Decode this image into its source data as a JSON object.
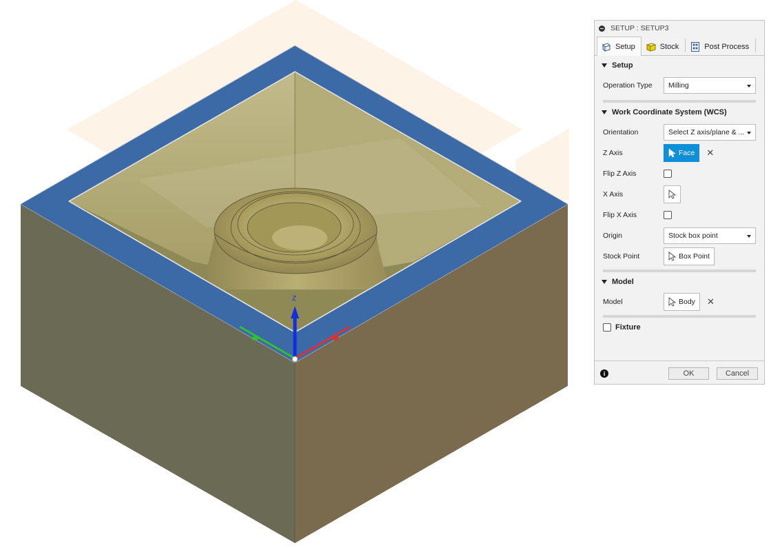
{
  "viewport": {
    "axis_label": "Z",
    "colors": {
      "front_left": "#6b6a55",
      "front_right": "#7a6b4e",
      "rim": "#3c6aa6",
      "inner": "#a8a06a",
      "boss": "#b0a56c",
      "ghost": "#fdf3e6",
      "z_axis": "#1030e0",
      "x_axis": "#e03030",
      "y_axis": "#30c030"
    }
  },
  "dialog": {
    "title": "SETUP : SETUP3",
    "tabs": [
      {
        "label": "Setup",
        "icon": "setup-icon"
      },
      {
        "label": "Stock",
        "icon": "stock-cube-icon"
      },
      {
        "label": "Post Process",
        "icon": "post-process-icon"
      }
    ],
    "setup_section": {
      "title": "Setup",
      "operation_type_label": "Operation Type",
      "operation_type_value": "Milling"
    },
    "wcs_section": {
      "title": "Work Coordinate System (WCS)",
      "orientation_label": "Orientation",
      "orientation_value": "Select Z axis/plane & ...",
      "z_axis_label": "Z Axis",
      "z_axis_value": "Face",
      "flip_z_label": "Flip Z Axis",
      "x_axis_label": "X Axis",
      "flip_x_label": "Flip X Axis",
      "origin_label": "Origin",
      "origin_value": "Stock box point",
      "stock_point_label": "Stock Point",
      "stock_point_value": "Box Point"
    },
    "model_section": {
      "title": "Model",
      "model_label": "Model",
      "model_value": "Body"
    },
    "fixture_label": "Fixture",
    "ok_label": "OK",
    "cancel_label": "Cancel",
    "accent_color": "#0e8fd8"
  }
}
